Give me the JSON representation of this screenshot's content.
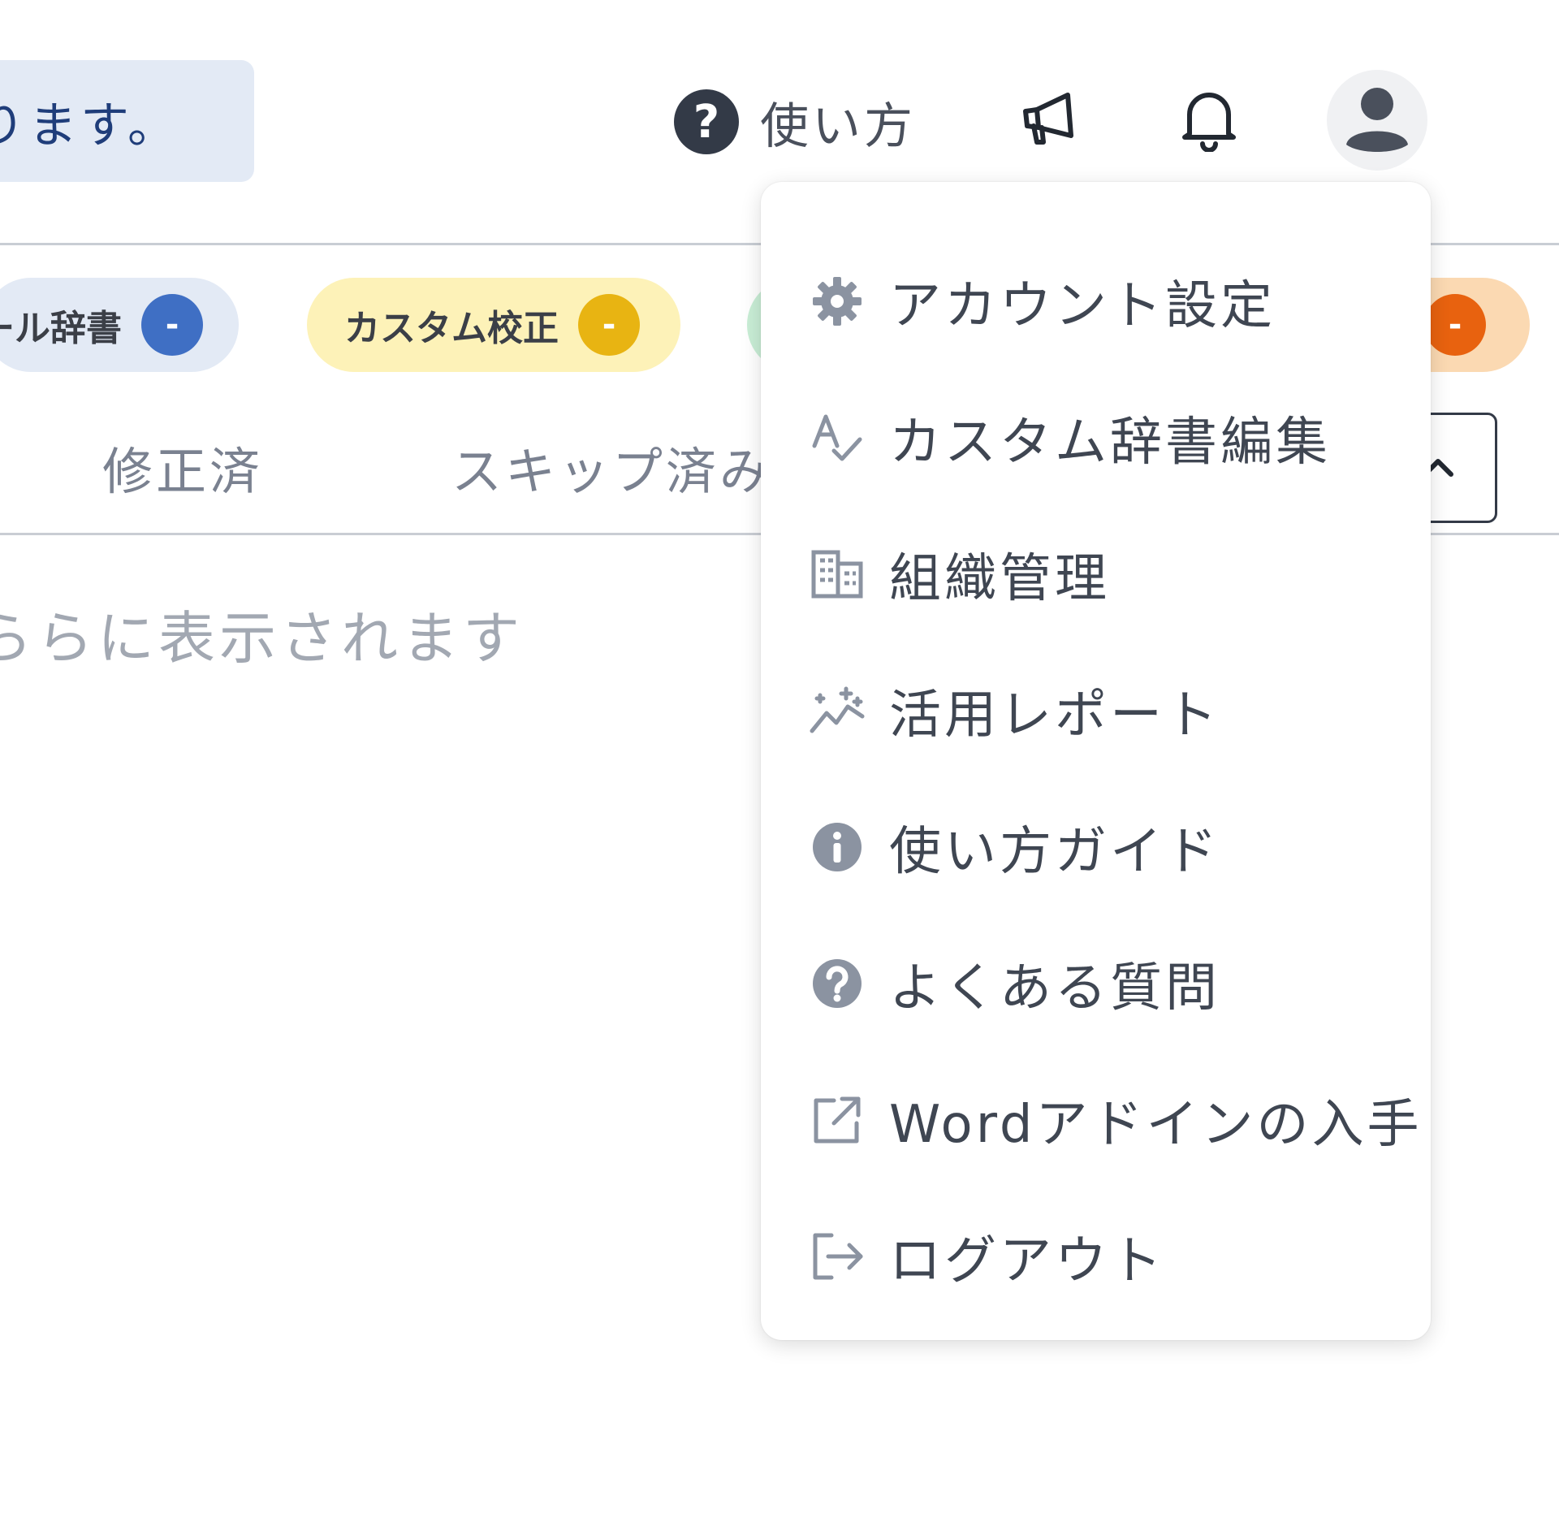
{
  "notice": {
    "text": "ります。"
  },
  "header": {
    "help_label": "使い方",
    "help_icon": "question-circle-icon",
    "announcement_icon": "megaphone-icon",
    "notification_icon": "bell-icon",
    "avatar_icon": "user-icon"
  },
  "chips": [
    {
      "label": "ール辞書",
      "count": "-",
      "bg": "#e3eaf5",
      "dot": "#3f6fc4"
    },
    {
      "label": "カスタム校正",
      "count": "-",
      "bg": "#fdf2b8",
      "dot": "#e8b412"
    },
    {
      "label": "",
      "count": "",
      "bg": "#c9eed6",
      "dot": "#2fae62"
    },
    {
      "label": "",
      "count": "-",
      "bg": "#fbd9b2",
      "dot": "#e8620f"
    }
  ],
  "tabs": [
    {
      "label": "修正済"
    },
    {
      "label": "スキップ済み"
    }
  ],
  "hint": "ららに表示されます",
  "menu": {
    "items": [
      {
        "label": "アカウント設定",
        "icon": "gear-icon"
      },
      {
        "label": "カスタム辞書編集",
        "icon": "spellcheck-icon"
      },
      {
        "label": "組織管理",
        "icon": "building-icon"
      },
      {
        "label": "活用レポート",
        "icon": "sparkline-icon"
      },
      {
        "label": "使い方ガイド",
        "icon": "info-circle-icon"
      },
      {
        "label": "よくある質問",
        "icon": "question-circle-icon"
      },
      {
        "label": "Wordアドインの入手",
        "icon": "external-link-icon"
      },
      {
        "label": "ログアウト",
        "icon": "logout-icon"
      }
    ]
  },
  "colors": {
    "accent_dark": "#333a47",
    "menu_icon": "#8b93a1",
    "notice_bg": "#e3eaf5"
  }
}
